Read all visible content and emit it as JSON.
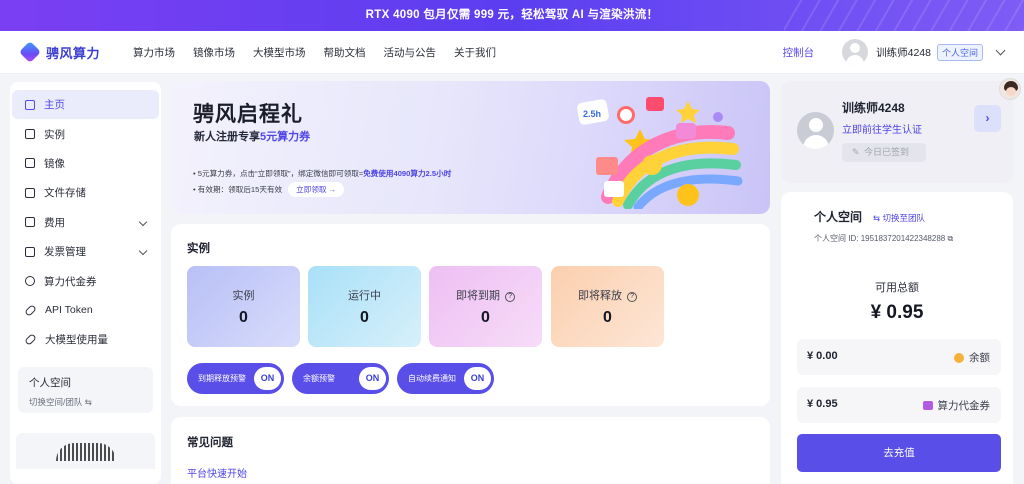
{
  "banner": {
    "text": "RTX 4090 包月仅需 999 元，轻松驾驭 AI 与渲染洪流！"
  },
  "header": {
    "logo_text": "骋风算力",
    "nav": [
      "算力市场",
      "镜像市场",
      "大模型市场",
      "帮助文档",
      "活动与公告",
      "关于我们"
    ],
    "console": "控制台",
    "user_name": "训练师4248",
    "space_tag": "个人空间"
  },
  "sidebar": {
    "items": [
      {
        "label": "主页",
        "icon": "home-icon",
        "active": true
      },
      {
        "label": "实例",
        "icon": "instance-icon"
      },
      {
        "label": "镜像",
        "icon": "image-icon"
      },
      {
        "label": "文件存储",
        "icon": "folder-icon"
      },
      {
        "label": "费用",
        "icon": "bill-icon",
        "expandable": true
      },
      {
        "label": "发票管理",
        "icon": "invoice-icon",
        "expandable": true
      },
      {
        "label": "算力代金券",
        "icon": "voucher-icon"
      },
      {
        "label": "API Token",
        "icon": "link-icon"
      },
      {
        "label": "大模型使用量",
        "icon": "link-icon"
      }
    ],
    "space": {
      "title": "个人空间",
      "sub": "切换空间/团队 ⇆"
    }
  },
  "promo": {
    "title": "骋风启程礼",
    "sub_prefix": "新人注册专享",
    "sub_highlight": "5元算力券",
    "line1_prefix": "• 5元算力券，点击“立即领取”，绑定微信即可领取≈",
    "line1_bold": "免费使用4090算力2.5小时",
    "line2": "• 有效期：领取后15天有效",
    "claim": "立即领取 →",
    "art_badge": "2.5h"
  },
  "instances": {
    "title": "实例",
    "stats": [
      {
        "label": "实例",
        "value": "0"
      },
      {
        "label": "运行中",
        "value": "0"
      },
      {
        "label": "即将到期",
        "value": "0",
        "help": true
      },
      {
        "label": "即将释放",
        "value": "0",
        "help": true
      }
    ],
    "toggles": [
      {
        "label": "到期释放预警",
        "state": "ON"
      },
      {
        "label": "余额预警",
        "state": "ON"
      },
      {
        "label": "自动续费通知",
        "state": "ON"
      }
    ]
  },
  "faq": {
    "title": "常见问题",
    "link": "平台快速开始"
  },
  "profile": {
    "name": "训练师4248",
    "cert": "立即前往学生认证",
    "checkin": "今日已签到"
  },
  "wallet": {
    "title": "个人空间",
    "switch": "⇆ 切换至团队",
    "id_label": "个人空间 ID:",
    "id_value": "1951837201422348288",
    "available_label": "可用总额",
    "available_total": "¥ 0.95",
    "rows": [
      {
        "amount": "¥ 0.00",
        "tag": "余额"
      },
      {
        "amount": "¥ 0.95",
        "tag": "算力代金券"
      }
    ],
    "charge": "去充值"
  },
  "colors": {
    "accent": "#5a4ee8",
    "banner": "#6a3ff0"
  }
}
